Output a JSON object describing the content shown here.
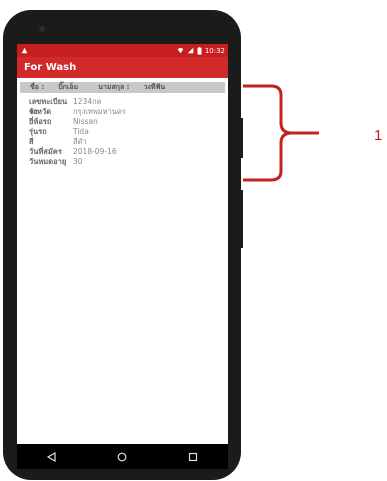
{
  "status": {
    "time": "10:32"
  },
  "app": {
    "title": "For Wash"
  },
  "header": {
    "name_label": "ชื่อ :",
    "name_value": "บิ๊กเอ็ม",
    "surname_label": "นามสกุล :",
    "surname_value": "วงทีฟัน"
  },
  "details": [
    {
      "label": "เลขทะเบียนรถ",
      "value": "1234กค"
    },
    {
      "label": "จังหวัด",
      "value": "กรุงเทพมหานคร"
    },
    {
      "label": "ยี่ห้อรถ",
      "value": "Nissan"
    },
    {
      "label": "รุ่นรถ",
      "value": "Tida"
    },
    {
      "label": "สี",
      "value": "สีดำ"
    },
    {
      "label": "วันที่สมัคร",
      "value": "2018-09-16"
    },
    {
      "label": "วันหมดอายุ",
      "value": "30"
    }
  ],
  "annotation": {
    "number": "1"
  },
  "colors": {
    "accent": "#d22a2a",
    "bracket": "#c32222"
  },
  "icons": [
    "wifi-icon",
    "signal-icon",
    "battery-icon",
    "back-icon",
    "home-icon",
    "recents-icon",
    "notification-icon"
  ]
}
